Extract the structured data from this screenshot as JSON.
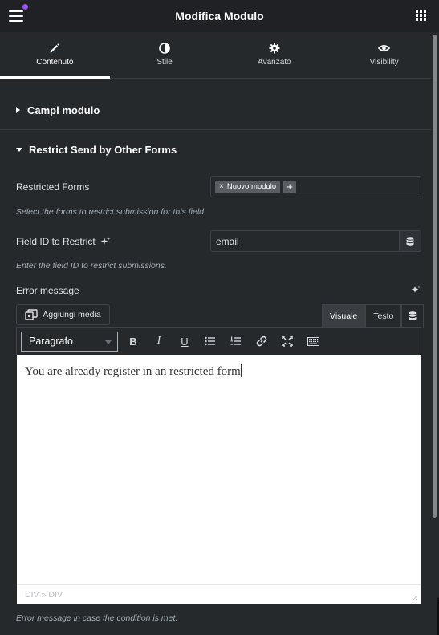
{
  "header": {
    "title": "Modifica Modulo"
  },
  "tabs": [
    {
      "label": "Contenuto",
      "icon": "pencil-icon",
      "active": true
    },
    {
      "label": "Stile",
      "icon": "contrast-icon",
      "active": false
    },
    {
      "label": "Avanzato",
      "icon": "gear-icon",
      "active": false
    },
    {
      "label": "Visibility",
      "icon": "eye-icon",
      "active": false
    }
  ],
  "sections": {
    "campi": {
      "title": "Campi modulo",
      "expanded": false
    },
    "restrict": {
      "title": "Restrict Send by Other Forms",
      "expanded": true
    }
  },
  "fields": {
    "restricted_forms": {
      "label": "Restricted Forms",
      "tags": [
        "Nuovo modulo"
      ],
      "tag_remove": "×",
      "add_symbol": "+",
      "help": "Select the forms to restrict submission for this field."
    },
    "field_id": {
      "label": "Field ID to Restrict",
      "value": "email",
      "help": "Enter the field ID to restrict submissions."
    },
    "error_message": {
      "label": "Error message",
      "add_media": "Aggiungi media",
      "mode_visual": "Visuale",
      "mode_text": "Testo",
      "format": "Paragrafo",
      "content": "You are already register in an restricted form",
      "path": [
        "DIV",
        "DIV"
      ],
      "path_sep": "»",
      "help": "Error message in case the condition is met."
    }
  },
  "toolbar": {
    "bold": "B",
    "italic": "I",
    "underline": "U"
  },
  "colors": {
    "background": "#26292c",
    "header": "#1f2124",
    "accent_dot": "#9b51ff"
  }
}
